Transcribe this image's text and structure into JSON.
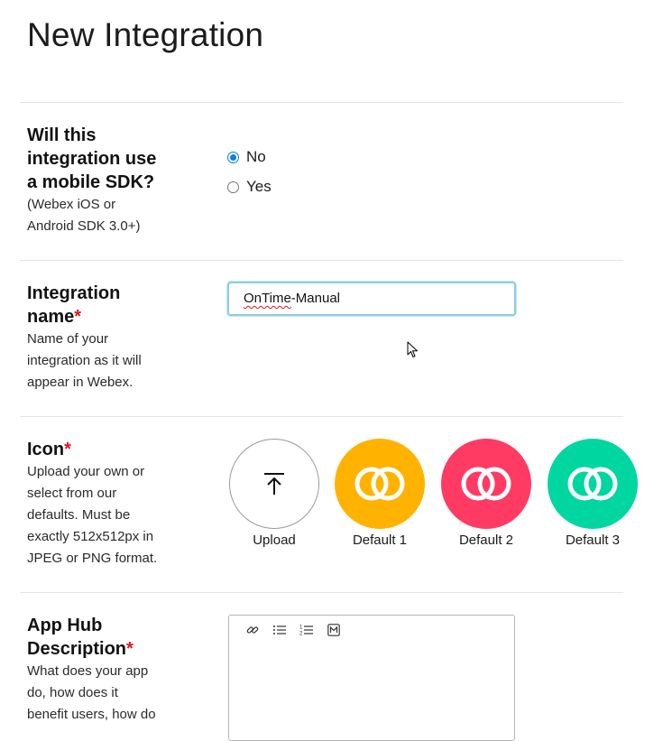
{
  "page": {
    "title": "New Integration"
  },
  "mobile_sdk": {
    "heading": "Will this integration use a mobile SDK?",
    "help": "(Webex iOS or Android SDK 3.0+)",
    "options": [
      {
        "label": "No",
        "selected": true
      },
      {
        "label": "Yes",
        "selected": false
      }
    ]
  },
  "integration_name": {
    "heading": "Integration name",
    "required_mark": "*",
    "help": "Name of your integration as it will appear in Webex.",
    "value_spellchecked": "OnTime",
    "value_rest": "-Manual"
  },
  "icon": {
    "heading": "Icon",
    "required_mark": "*",
    "help": "Upload your own or select from our defaults. Must be exactly 512x512px in JPEG or PNG format.",
    "upload_label": "Upload",
    "defaults": [
      {
        "label": "Default 1",
        "color": "#ffb300"
      },
      {
        "label": "Default 2",
        "color": "#ff3a63"
      },
      {
        "label": "Default 3",
        "color": "#00d6a0"
      }
    ]
  },
  "app_hub": {
    "heading": "App Hub Description",
    "required_mark": "*",
    "help": "What does your app do, how does it benefit users, how do",
    "toolbar_icons": [
      "link-icon",
      "bulleted-list-icon",
      "numbered-list-icon",
      "markdown-icon"
    ]
  }
}
